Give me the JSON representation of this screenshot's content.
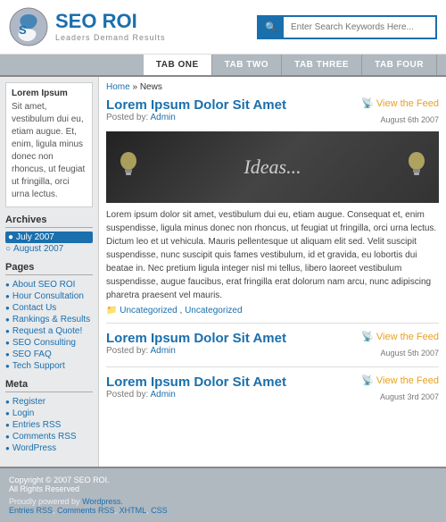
{
  "header": {
    "logo_title_seo": "SEO",
    "logo_title_roi": " ROI",
    "logo_subtitle": "Leaders Demand Results",
    "search_placeholder": "Enter Search Keywords Here...",
    "search_button_icon": "🔍"
  },
  "nav": {
    "tabs": [
      {
        "label": "TAB ONE",
        "active": true
      },
      {
        "label": "TAB TWO",
        "active": false
      },
      {
        "label": "TAB THREE",
        "active": false
      },
      {
        "label": "TAB FOUR",
        "active": false
      }
    ]
  },
  "sidebar": {
    "featured_title": "Lorem Ipsum",
    "featured_text": "Sit amet, vestibulum dui eu, etiam augue. Et, enim, ligula minus donec non rhoncus, ut feugiat ut fringilla, orci urna lectus.",
    "archives_title": "Archives",
    "archives_months": [
      {
        "label": "July 2007",
        "active": true
      },
      {
        "label": "August 2007",
        "active": false
      }
    ],
    "pages_title": "Pages",
    "pages_links": [
      "About SEO ROI",
      "Hour Consultation",
      "Contact Us",
      "Rankings & Results",
      "Request a Quote!",
      "SEO Consulting",
      "SEO FAQ",
      "Tech Support"
    ],
    "meta_title": "Meta",
    "meta_links": [
      "Register",
      "Login",
      "Entries RSS",
      "Comments RSS",
      "WordPress"
    ]
  },
  "breadcrumb": {
    "home": "Home",
    "separator": "»",
    "current": "News"
  },
  "posts": [
    {
      "title": "Lorem Ipsum Dolor Sit Amet",
      "meta_prefix": "Posted by:",
      "meta_author": "Admin",
      "feed_label": "View the Feed",
      "feed_date": "August 6th 2007",
      "has_ideas_image": true,
      "ideas_text": "Ideas...",
      "body": "Lorem ipsum dolor sit amet, vestibulum dui eu, etiam augue. Consequat et, enim suspendisse, ligula minus donec non rhoncus, ut feugiat ut fringilla, orci urna lectus. Dictum leo et ut vehicula. Mauris pellentesque ut aliquam elit sed. Velit suscipit suspendisse, nunc suscipit quis fames vestibulum, id et gravida, eu lobortis dui beatae in. Nec pretium ligula integer nisl mi tellus, libero laoreet vestibulum suspendisse, augue faucibus, erat fringilla erat dolorum nam arcu, nunc adipiscing pharetra praesent vel mauris.",
      "cats_prefix": "Uncategorized",
      "cats_2": "Uncategorized"
    },
    {
      "title": "Lorem Ipsum Dolor Sit Amet",
      "meta_prefix": "Posted by:",
      "meta_author": "Admin",
      "feed_label": "View the Feed",
      "feed_date": "August 5th 2007",
      "has_ideas_image": false,
      "body": "",
      "cats_prefix": "",
      "cats_2": ""
    },
    {
      "title": "Lorem Ipsum Dolor Sit Amet",
      "meta_prefix": "Posted by:",
      "meta_author": "Admin",
      "feed_label": "View the Feed",
      "feed_date": "August 3rd 2007",
      "has_ideas_image": false,
      "body": "",
      "cats_prefix": "",
      "cats_2": ""
    }
  ],
  "footer": {
    "copyright": "Copyright © 2007 SEO ROI.",
    "rights": "All Rights Reserved",
    "powered_prefix": "Proudly powered by",
    "powered_link": "Wordpress.",
    "footer_links": [
      "Entries RSS",
      "Comments RSS",
      "XHTML",
      "CSS"
    ]
  }
}
